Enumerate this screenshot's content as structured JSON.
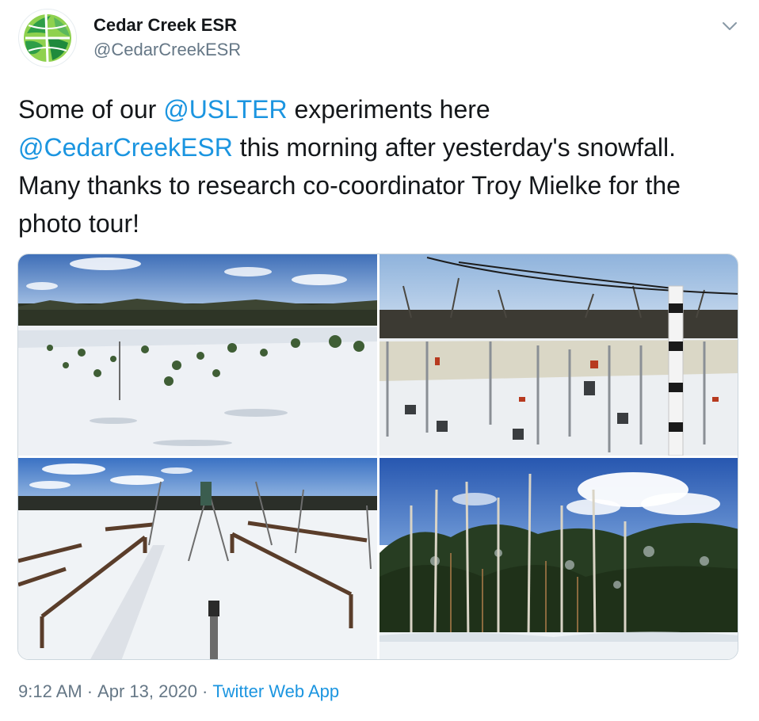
{
  "author": {
    "name": "Cedar Creek ESR",
    "handle": "@CedarCreekESR"
  },
  "tweet": {
    "text_1": "Some of our ",
    "mention_1": "@USLTER",
    "text_2": " experiments here\n",
    "mention_2": "@CedarCreekESR",
    "text_3": " this morning after yesterday's snowfall. Many thanks to research co-coordinator Troy Mielke for the photo tour!"
  },
  "meta": {
    "time": "9:12 AM",
    "separator": "·",
    "date": "Apr 13, 2020",
    "source": "Twitter Web App"
  },
  "colors": {
    "link": "#1b95e0",
    "secondary_text": "#657786",
    "primary_text": "#14171a"
  },
  "icons": {
    "caret": "chevron-down-icon",
    "avatar": "globe-logo"
  }
}
